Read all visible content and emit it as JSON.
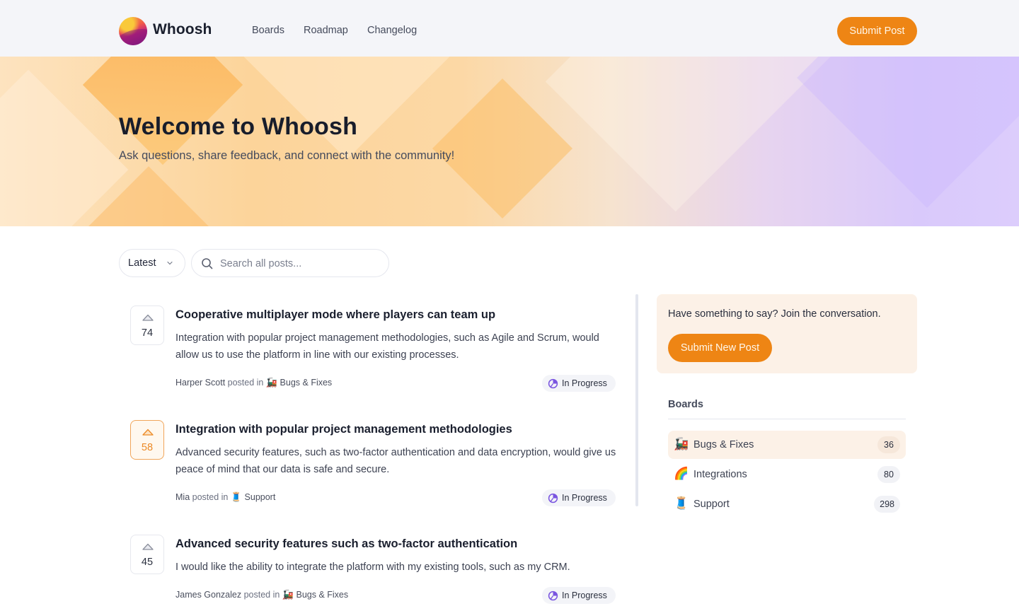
{
  "header": {
    "brand": "Whoosh",
    "nav": [
      "Boards",
      "Roadmap",
      "Changelog"
    ],
    "submit_label": "Submit Post"
  },
  "hero": {
    "title": "Welcome to Whoosh",
    "subtitle": "Ask questions, share feedback, and connect with the community!"
  },
  "filters": {
    "sort_selected": "Latest",
    "search_placeholder": "Search all posts...",
    "search_value": ""
  },
  "posts": [
    {
      "votes": "74",
      "voted": false,
      "title": "Cooperative multiplayer mode where players can team up",
      "body": "Integration with popular project management methodologies, such as Agile and Scrum, would allow us to use the platform in line with our existing processes.",
      "author": "Harper Scott",
      "posted_in": "posted in",
      "board_emoji": "🚂",
      "board": "Bugs & Fixes",
      "status": "In Progress"
    },
    {
      "votes": "58",
      "voted": true,
      "title": "Integration with popular project management methodologies",
      "body": "Advanced security features, such as two-factor authentication and data encryption, would give us peace of mind that our data is safe and secure.",
      "author": "Mia",
      "posted_in": "posted in",
      "board_emoji": "🧵",
      "board": "Support",
      "status": "In Progress"
    },
    {
      "votes": "45",
      "voted": false,
      "title": "Advanced security features such as two-factor authentication",
      "body": "I would like the ability to integrate the platform with my existing tools, such as my CRM.",
      "author": "James Gonzalez",
      "posted_in": "posted in",
      "board_emoji": "🚂",
      "board": "Bugs & Fixes",
      "status": "In Progress"
    }
  ],
  "sidebar": {
    "cta_text": "Have something to say? Join the conversation.",
    "cta_button": "Submit New Post",
    "boards_heading": "Boards",
    "boards": [
      {
        "emoji": "🚂",
        "name": "Bugs & Fixes",
        "count": "36",
        "active": true
      },
      {
        "emoji": "🌈",
        "name": "Integrations",
        "count": "80",
        "active": false
      },
      {
        "emoji": "🧵",
        "name": "Support",
        "count": "298",
        "active": false
      }
    ]
  },
  "colors": {
    "accent": "#ee8514",
    "status_icon": "#7a55e0",
    "cta_bg": "#fcf1e7"
  }
}
